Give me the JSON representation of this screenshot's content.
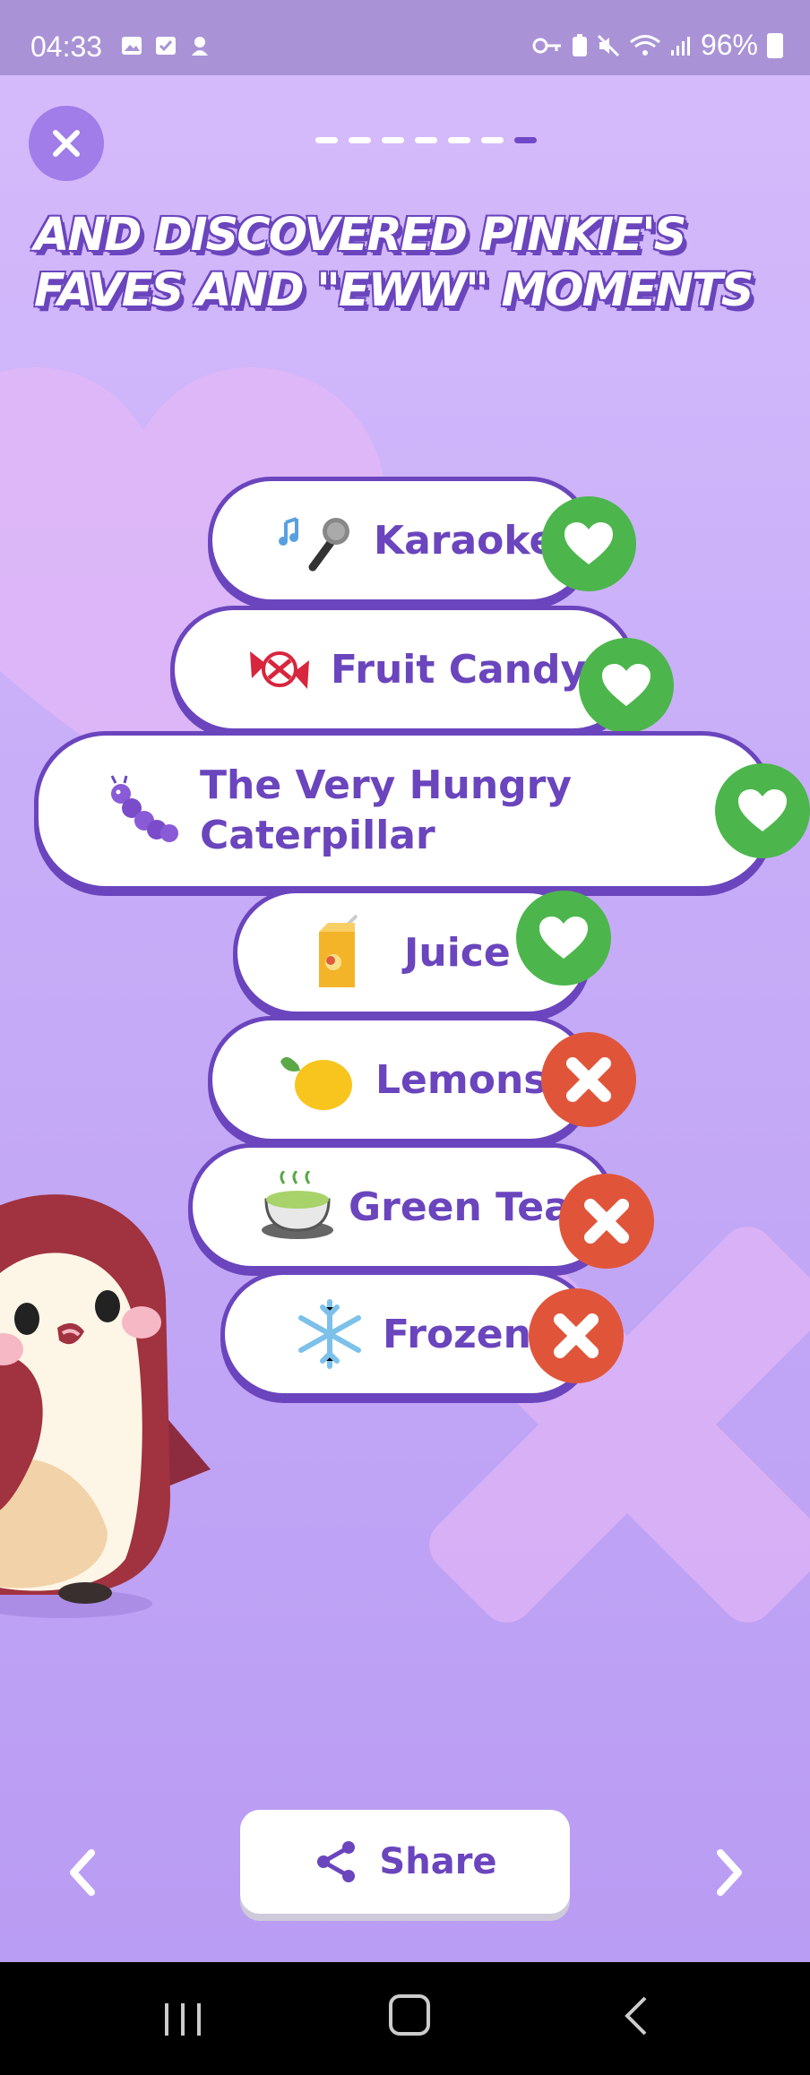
{
  "status_bar": {
    "time": "04:33",
    "battery": "96%"
  },
  "progress": {
    "total_steps": 7,
    "current_step": 7
  },
  "title": "AND DISCOVERED PINKIE'S FAVES AND \"EWW\" MOMENTS",
  "items": [
    {
      "label": "Karaoke",
      "icon": "microphone-icon",
      "verdict": "like"
    },
    {
      "label": "Fruit Candy",
      "icon": "candy-icon",
      "verdict": "like"
    },
    {
      "label": "The Very Hungry Caterpillar",
      "icon": "caterpillar-icon",
      "verdict": "like"
    },
    {
      "label": "Juice",
      "icon": "juice-box-icon",
      "verdict": "like"
    },
    {
      "label": "Lemons",
      "icon": "lemon-icon",
      "verdict": "dislike"
    },
    {
      "label": "Green Tea",
      "icon": "green-tea-icon",
      "verdict": "dislike"
    },
    {
      "label": "Frozen",
      "icon": "snowflake-icon",
      "verdict": "dislike"
    }
  ],
  "share": {
    "label": "Share"
  },
  "colors": {
    "accent": "#6a45bd",
    "like": "#4cb64c",
    "dislike": "#e0553a",
    "background": "#c8aef8"
  }
}
